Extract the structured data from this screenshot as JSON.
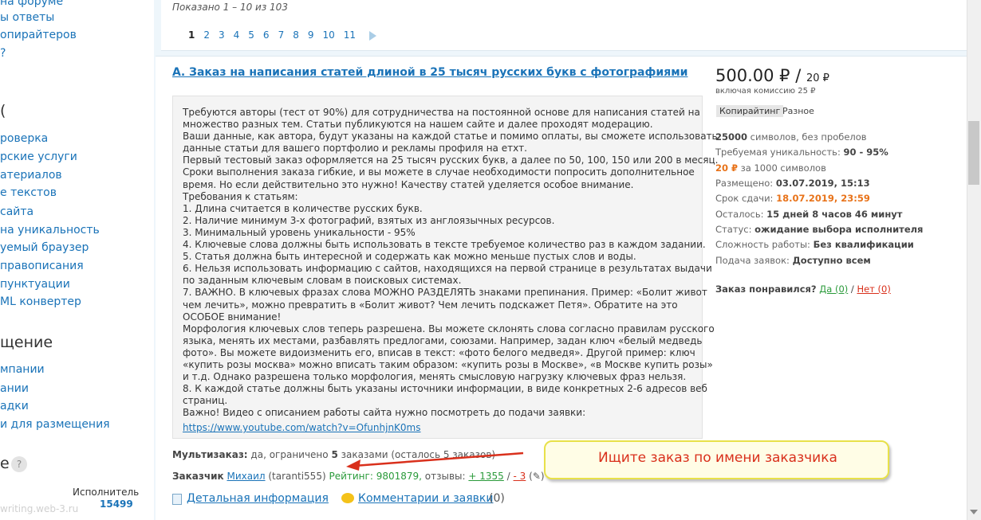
{
  "sidebar": {
    "links_top": [
      "на форуме",
      "ы ответы",
      "опирайтеров",
      "?"
    ],
    "section1_head": "(",
    "links_mid": [
      "роверка",
      "рские услуги",
      "атериалов",
      "е текстов",
      "сайта",
      "на уникальность",
      "уемый браузер",
      "правописания",
      "пунктуации",
      "ML конвертер"
    ],
    "section2_head": "щение",
    "links_bot": [
      "мпании",
      "ании",
      "адки",
      "и для размещения"
    ],
    "section3_head": "е",
    "help_icon": "?",
    "executor_label": "Исполнитель",
    "executor_count": "15499",
    "site_url": "writing.web-3.ru"
  },
  "listing": {
    "shown": "Показано 1 – 10 из 103",
    "pages": [
      "1",
      "2",
      "3",
      "4",
      "5",
      "6",
      "7",
      "8",
      "9",
      "10",
      "11"
    ],
    "current_page": "1"
  },
  "order": {
    "title": "А. Заказ на написания статей длиной в 25 тысяч русских букв с фотографиями",
    "description_lines": [
      "Требуются авторы (тест от 90%) для сотрудничества на постоянной основе для написания статей на",
      "множество разных тем. Статьи публикуются на нашем сайте и далее проходят модерацию.",
      "Ваши данные, как автора, будут указаны на каждой статье и помимо оплаты, вы сможете использовать",
      "данные статьи для вашего портфолио и рекламы профиля на етхт.",
      "Первый тестовый заказ оформляется на 25 тысяч русских букв, а далее по 50, 100, 150 или 200 в месяц.",
      "Сроки выполнения заказа гибкие, и вы можете в случае необходимости попросить дополнительное",
      "время. Но если действительно это нужно! Качеству статей уделяется особое внимание.",
      "Требования к статьям:",
      "1. Длина считается в количестве русских букв.",
      "2. Наличие минимум 3-х фотографий, взятых из англоязычных ресурсов.",
      "3. Минимальный уровень уникальности - 95%",
      "4. Ключевые слова должны быть использовать в тексте требуемое количество раз в каждом задании.",
      "5. Статья должна быть интересной и содержать как можно меньше пустых слов и воды.",
      "6. Нельзя использовать информацию с сайтов, находящихся на первой странице в результатах выдачи",
      "по заданным ключевым словам в поисковых системах.",
      "7. ВАЖНО. В ключевых фразах слова МОЖНО РАЗДЕЛЯТЬ знаками препинания. Пример: «Болит живот",
      "чем лечить», можно превратить в «Болит живот? Чем лечить подскажет Петя». Обратите на это",
      "ОСОБОЕ внимание!",
      "Морфология ключевых слов теперь разрешена. Вы можете склонять слова согласно правилам русского",
      "языка, менять их местами, разбавлять предлогами, союзами. Например, задан ключ «белый медведь",
      "фото». Вы можете видоизменить его, вписав в текст: «фото белого медведя». Другой пример: ключ",
      "«купить розы москва» можно вписать таким образом: «купить розы в Москве», «в Москве купить розы»",
      "и т.д. Однако разрешена только морфология, менять смысловую нагрузку ключевых фраз нельзя.",
      "8. К каждой статье должны быть указаны источники информации, в виде конкретных 2-6 адресов веб",
      "страниц.",
      "Важно! Видео с описанием работы сайта нужно посмотреть до подачи заявки:"
    ],
    "video_link": "https://www.youtube.com/watch?v=OfunhjnK0ms",
    "price_main": "500.00 ₽ /",
    "price_per": "20 ₽",
    "commission": "включая комиссию 25 ₽",
    "category": "Копирайтинг",
    "subcategory": "Разное",
    "chars_value": "25000",
    "chars_text": "символов, без пробелов",
    "uniq_label": "Требуемая уникальность:",
    "uniq_value": "90 - 95%",
    "rate_value": "20 ₽",
    "rate_text": "за 1000 символов",
    "posted_label": "Размещено:",
    "posted_value": "03.07.2019, 15:13",
    "deadline_label": "Срок сдачи:",
    "deadline_value": "18.07.2019, 23:59",
    "remaining_label": "Осталось:",
    "remaining_value": "15 дней 8 часов 46 минут",
    "status_label": "Статус:",
    "status_value": "ожидание выбора исполнителя",
    "complexity_label": "Сложность работы:",
    "complexity_value": "Без квалификации",
    "apply_label": "Подача заявок:",
    "apply_value": "Доступно всем",
    "liked_label": "Заказ понравился?",
    "liked_yes": "Да (0)",
    "liked_sep": "/",
    "liked_no": "Нет (0)",
    "multi_label": "Мультизаказ:",
    "multi_text1": "да, ограничено",
    "multi_count": "5",
    "multi_text2": "заказами (осталось 5 заказов)",
    "customer_label": "Заказчик",
    "customer_name": "Михаил",
    "customer_login": "(taranti555)",
    "rating_label": "Рейтинг:",
    "rating_value": "9801879,",
    "reviews_label": "отзывы:",
    "reviews_pos": "+ 1355",
    "reviews_sep": "/",
    "reviews_neg": "- 3",
    "reviews_paren_open": "(",
    "reviews_paren_close": ")",
    "details_link": "Детальная информация",
    "comments_link": "Комментарии и заявки",
    "comments_count": "(0)"
  },
  "annotation": {
    "callout_text": "Ищите заказ по имени заказчика",
    "color": "#d9301c"
  }
}
